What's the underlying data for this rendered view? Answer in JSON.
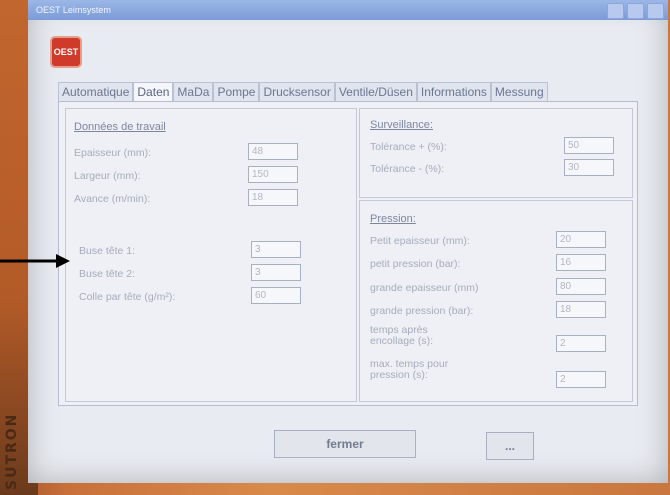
{
  "window": {
    "title": "OEST Leimsystem"
  },
  "brand": {
    "vendor": "SUTRON"
  },
  "logo": {
    "text": "OEST"
  },
  "tabs": [
    {
      "label": "Automatique",
      "active": false
    },
    {
      "label": "Daten",
      "active": true
    },
    {
      "label": "MaDa",
      "active": false
    },
    {
      "label": "Pompe",
      "active": false
    },
    {
      "label": "Drucksensor",
      "active": false
    },
    {
      "label": "Ventile/Düsen",
      "active": false
    },
    {
      "label": "Informations",
      "active": false
    },
    {
      "label": "Messung",
      "active": false
    }
  ],
  "donnees": {
    "header": "Données de travail",
    "rows": [
      {
        "label": "Epaisseur (mm):",
        "value": "48"
      },
      {
        "label": "Largeur (mm):",
        "value": "150"
      },
      {
        "label": "Avance (m/min):",
        "value": "18"
      }
    ]
  },
  "buse": {
    "rows": [
      {
        "label": "Buse tête 1:",
        "value": "3"
      },
      {
        "label": "Buse tête 2:",
        "value": "3"
      },
      {
        "label": "Colle par tête (g/m²):",
        "value": "60"
      }
    ]
  },
  "surveillance": {
    "header": "Surveillance:",
    "rows": [
      {
        "label": "Tolérance + (%):",
        "value": "50"
      },
      {
        "label": "Tolérance - (%):",
        "value": "30"
      }
    ]
  },
  "pression": {
    "header": "Pression:",
    "rows": [
      {
        "label": "Petit epaisseur (mm):",
        "value": "20"
      },
      {
        "label": "petit pression (bar):",
        "value": "16"
      },
      {
        "label": "grande epaisseur (mm)",
        "value": "80"
      },
      {
        "label": "grande pression (bar):",
        "value": "18"
      },
      {
        "label": "temps après encollage (s):",
        "value": "2"
      },
      {
        "label": "max. temps pour pression (s):",
        "value": "2"
      }
    ]
  },
  "buttons": {
    "close": "fermer",
    "more": "..."
  },
  "colors": {
    "accent": "#cf3b2b",
    "titlebar": "#7c9bd6",
    "bezel": "#c9703a"
  }
}
